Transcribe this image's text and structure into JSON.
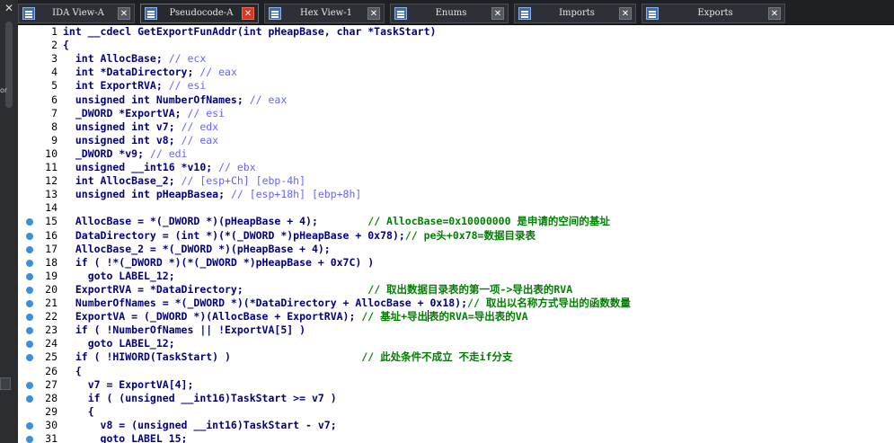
{
  "left_panel": {
    "close_glyph": "✕",
    "fragment_label": "or"
  },
  "tabs": [
    {
      "label": "IDA View-A",
      "active": false,
      "close_red": false
    },
    {
      "label": "Pseudocode-A",
      "active": true,
      "close_red": true
    },
    {
      "label": "Hex View-1",
      "active": false,
      "close_red": false
    },
    {
      "label": "Enums",
      "active": false,
      "close_red": false
    },
    {
      "label": "Imports",
      "active": false,
      "close_red": false
    },
    {
      "label": "Exports",
      "active": false,
      "close_red": false
    }
  ],
  "tab_close_glyph": "✕",
  "code_lines": [
    {
      "n": "1",
      "bp": false,
      "parts": [
        [
          "c",
          "int __cdecl GetExportFunAddr(int pHeapBase, char *TaskStart)"
        ]
      ]
    },
    {
      "n": "2",
      "bp": false,
      "parts": [
        [
          "c",
          "{"
        ]
      ]
    },
    {
      "n": "3",
      "bp": false,
      "parts": [
        [
          "c",
          "  int AllocBase; "
        ],
        [
          "m",
          "// ecx"
        ]
      ]
    },
    {
      "n": "4",
      "bp": false,
      "parts": [
        [
          "c",
          "  int *DataDirectory; "
        ],
        [
          "m",
          "// eax"
        ]
      ]
    },
    {
      "n": "5",
      "bp": false,
      "parts": [
        [
          "c",
          "  int ExportRVA; "
        ],
        [
          "m",
          "// esi"
        ]
      ]
    },
    {
      "n": "6",
      "bp": false,
      "parts": [
        [
          "c",
          "  unsigned int NumberOfNames; "
        ],
        [
          "m",
          "// eax"
        ]
      ]
    },
    {
      "n": "7",
      "bp": false,
      "parts": [
        [
          "c",
          "  _DWORD *ExportVA; "
        ],
        [
          "m",
          "// esi"
        ]
      ]
    },
    {
      "n": "8",
      "bp": false,
      "parts": [
        [
          "c",
          "  unsigned int v7; "
        ],
        [
          "m",
          "// edx"
        ]
      ]
    },
    {
      "n": "9",
      "bp": false,
      "parts": [
        [
          "c",
          "  unsigned int v8; "
        ],
        [
          "m",
          "// eax"
        ]
      ]
    },
    {
      "n": "10",
      "bp": false,
      "parts": [
        [
          "c",
          "  _DWORD *v9; "
        ],
        [
          "m",
          "// edi"
        ]
      ]
    },
    {
      "n": "11",
      "bp": false,
      "parts": [
        [
          "c",
          "  unsigned __int16 *v10; "
        ],
        [
          "m",
          "// ebx"
        ]
      ]
    },
    {
      "n": "12",
      "bp": false,
      "parts": [
        [
          "c",
          "  int AllocBase_2; "
        ],
        [
          "m",
          "// [esp+Ch] [ebp-4h]"
        ]
      ]
    },
    {
      "n": "13",
      "bp": false,
      "parts": [
        [
          "c",
          "  unsigned int pHeapBasea; "
        ],
        [
          "m",
          "// [esp+18h] [ebp+8h]"
        ]
      ]
    },
    {
      "n": "14",
      "bp": false,
      "parts": [
        [
          "c",
          ""
        ]
      ]
    },
    {
      "n": "15",
      "bp": true,
      "parts": [
        [
          "c",
          "  AllocBase = *(_DWORD *)(pHeapBase + 4);        "
        ],
        [
          "g",
          "// AllocBase=0x10000000 是申请的空间的基址"
        ]
      ]
    },
    {
      "n": "16",
      "bp": true,
      "parts": [
        [
          "c",
          "  DataDirectory = (int *)(*(_DWORD *)pHeapBase + 0x78);"
        ],
        [
          "g",
          "// pe头+0x78=数据目录表"
        ]
      ]
    },
    {
      "n": "17",
      "bp": true,
      "parts": [
        [
          "c",
          "  AllocBase_2 = *(_DWORD *)(pHeapBase + 4);"
        ]
      ]
    },
    {
      "n": "18",
      "bp": true,
      "parts": [
        [
          "c",
          "  if ( !*(_DWORD *)(*(_DWORD *)pHeapBase + 0x7C) )"
        ]
      ]
    },
    {
      "n": "19",
      "bp": true,
      "parts": [
        [
          "c",
          "    goto LABEL_12;"
        ]
      ]
    },
    {
      "n": "20",
      "bp": true,
      "parts": [
        [
          "c",
          "  ExportRVA = *DataDirectory;                    "
        ],
        [
          "g",
          "// 取出数据目录表的第一项->导出表的RVA"
        ]
      ]
    },
    {
      "n": "21",
      "bp": true,
      "parts": [
        [
          "c",
          "  NumberOfNames = *(_DWORD *)(*DataDirectory + AllocBase + 0x18);"
        ],
        [
          "g",
          "// 取出以名称方式导出的函数数量"
        ]
      ]
    },
    {
      "n": "22",
      "bp": true,
      "parts": [
        [
          "c",
          "  ExportVA = (_DWORD *)(AllocBase + ExportRVA); "
        ],
        [
          "g",
          "// 基址+导出"
        ],
        [
          "cur",
          ""
        ],
        [
          "g",
          "表的RVA=导出表的VA"
        ]
      ]
    },
    {
      "n": "23",
      "bp": true,
      "parts": [
        [
          "c",
          "  if ( !NumberOfNames || !ExportVA[5] )"
        ]
      ]
    },
    {
      "n": "24",
      "bp": true,
      "parts": [
        [
          "c",
          "    goto LABEL_12;"
        ]
      ]
    },
    {
      "n": "25",
      "bp": true,
      "parts": [
        [
          "c",
          "  if ( !HIWORD(TaskStart) )                     "
        ],
        [
          "g",
          "// 此处条件不成立 不走if分支"
        ]
      ]
    },
    {
      "n": "26",
      "bp": false,
      "parts": [
        [
          "c",
          "  {"
        ]
      ]
    },
    {
      "n": "27",
      "bp": true,
      "parts": [
        [
          "c",
          "    v7 = ExportVA[4];"
        ]
      ]
    },
    {
      "n": "28",
      "bp": true,
      "parts": [
        [
          "c",
          "    if ( (unsigned __int16)TaskStart >= v7 )"
        ]
      ]
    },
    {
      "n": "29",
      "bp": false,
      "parts": [
        [
          "c",
          "    {"
        ]
      ]
    },
    {
      "n": "30",
      "bp": true,
      "parts": [
        [
          "c",
          "      v8 = (unsigned __int16)TaskStart - v7;"
        ]
      ]
    },
    {
      "n": "31",
      "bp": true,
      "parts": [
        [
          "c",
          "      goto LABEL_15;"
        ]
      ]
    }
  ]
}
